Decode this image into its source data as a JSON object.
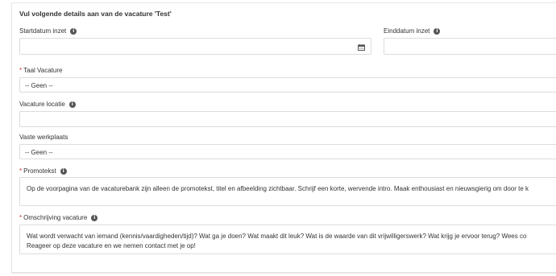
{
  "form": {
    "heading": "Vul volgende details aan van de vacature 'Test'",
    "start_date": {
      "label": "Startdatum inzet",
      "value": ""
    },
    "end_date": {
      "label": "Einddatum inzet",
      "value": ""
    },
    "language": {
      "required_mark": "*",
      "label": "Taal Vacature",
      "value": "-- Geen --"
    },
    "location": {
      "label": "Vacature locatie",
      "value": ""
    },
    "workplace": {
      "label": "Vaste werkplaats",
      "value": "-- Geen --"
    },
    "promo": {
      "required_mark": "*",
      "label": "Promotekst",
      "value": "Op de voorpagina van de vacaturebank zijn alleen de promotekst, titel en afbeelding zichtbaar. Schrijf een korte, wervende intro. Maak enthousiast en nieuwsgierig om door te k"
    },
    "description": {
      "required_mark": "*",
      "label": "Omschrijving vacature",
      "line1": "Wat wordt verwacht van iemand (kennis/vaardigheden/tijd)? Wat ga je doen? Wat maakt dit leuk? Wat is de waarde van dit vrijwilligerswerk?  Wat krijg je ervoor terug? Wees co",
      "line2": "Reageer op deze vacature en we nemen contact met je op!"
    }
  },
  "icons": {
    "info": "info-icon",
    "calendar": "calendar-icon"
  }
}
